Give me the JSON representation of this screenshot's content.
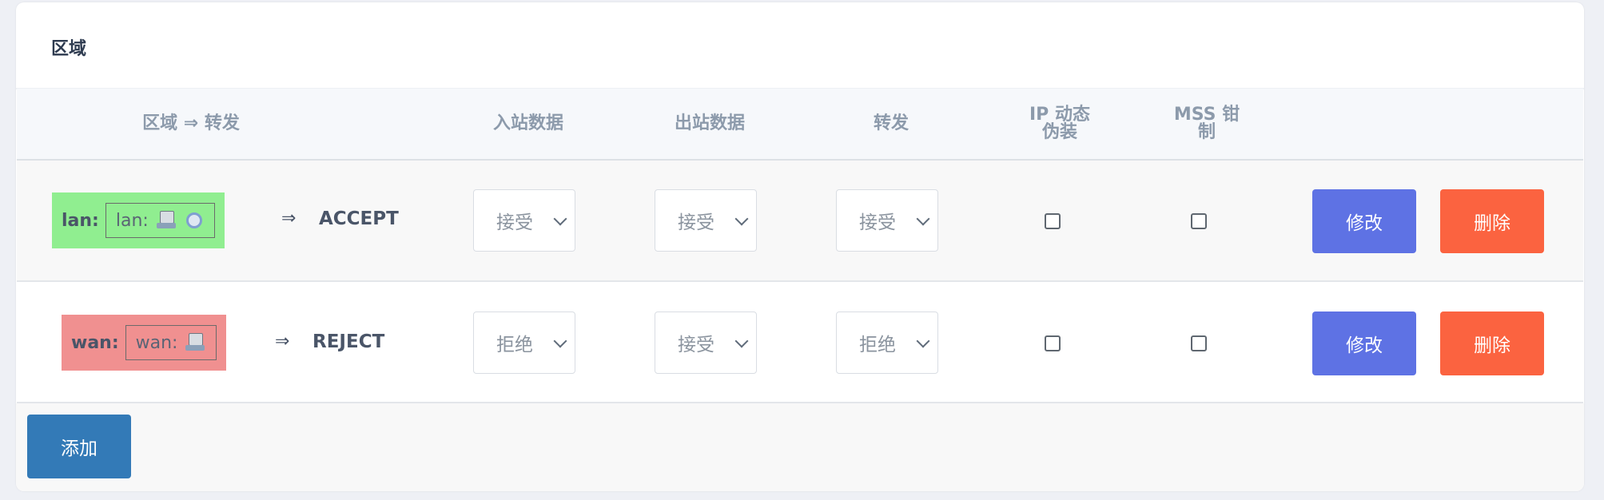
{
  "section_title": "区域",
  "columns": {
    "zone_forward": "区域 ⇒ 转发",
    "input": "入站数据",
    "output": "出站数据",
    "forward": "转发",
    "masq_line1": "IP 动态",
    "masq_line2": "伪装",
    "mss_line1": "MSS 钳",
    "mss_line2": "制"
  },
  "rows": [
    {
      "zone": "lan:",
      "network_label": "lan:",
      "icons": [
        "ethernet-icon",
        "wireless-icon"
      ],
      "arrow": "⇒",
      "forward_policy": "ACCEPT",
      "input": "接受",
      "output": "接受",
      "forward": "接受",
      "masquerade": false,
      "mss_clamping": false,
      "badge_color": "#90ee90",
      "edit_label": "修改",
      "delete_label": "删除"
    },
    {
      "zone": "wan:",
      "network_label": "wan:",
      "icons": [
        "ethernet-icon"
      ],
      "arrow": "⇒",
      "forward_policy": "REJECT",
      "input": "拒绝",
      "output": "接受",
      "forward": "拒绝",
      "masquerade": false,
      "mss_clamping": false,
      "badge_color": "#f09090",
      "edit_label": "修改",
      "delete_label": "删除"
    }
  ],
  "add_label": "添加",
  "colors": {
    "edit_button": "#5e72e4",
    "delete_button": "#fb6340",
    "add_button": "#337ab7"
  }
}
